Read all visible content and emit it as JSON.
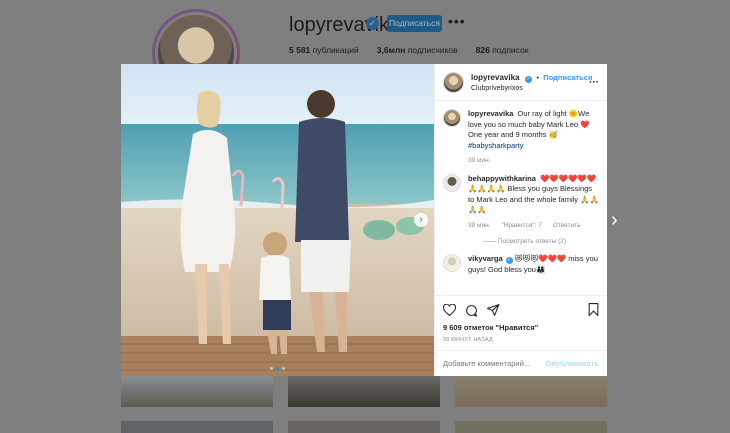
{
  "profile": {
    "username": "lopyrevavika",
    "verified_icon": "verified-badge-icon",
    "follow_label": "Подписаться",
    "more_icon": "more-options-icon",
    "stats": [
      {
        "value": "5 581",
        "label": "публикаций"
      },
      {
        "value": "3,6млн",
        "label": "подписчиков"
      },
      {
        "value": "826",
        "label": "подписок"
      }
    ]
  },
  "post": {
    "author": "lopyrevavika",
    "follow_label": "Подписаться",
    "separator": "•",
    "location": "Clubprivebyrixos",
    "more_label": "···",
    "photo_dots": 3,
    "photo_active_dot": 1,
    "caption": {
      "username": "lopyrevavika",
      "text": "Our ray of light 🌞We love you so much baby Mark Leo ❤️ One year and 9 months 🥳",
      "hashtag": "#babysharkparty",
      "time": "39 мин."
    },
    "comments": [
      {
        "username": "behappywithkarina",
        "text": "❤️❤️❤️❤️❤️❤️🙏🙏🙏🙏 Bless you guys Blessings to Mark Leo and the whole family 🙏🙏🙏🙏",
        "time": "38 мин.",
        "likes": "\"Нравится\": 7",
        "reply": "Ответить",
        "view_replies": "Посмотреть ответы (2)"
      },
      {
        "username": "vikyvarga",
        "text": "😻😻😻❤️❤️❤️ miss you guys! God bless you👨‍👩‍👧",
        "verified": true
      }
    ],
    "likes": "9 609 отметок \"Нравится\"",
    "time_ago": "38 МИНУТ НАЗАД",
    "comment_placeholder": "Добавьте комментарий...",
    "post_label": "Опубликовать"
  },
  "colors": {
    "accent": "#3897f0",
    "overlay": "#7f7f7f"
  }
}
